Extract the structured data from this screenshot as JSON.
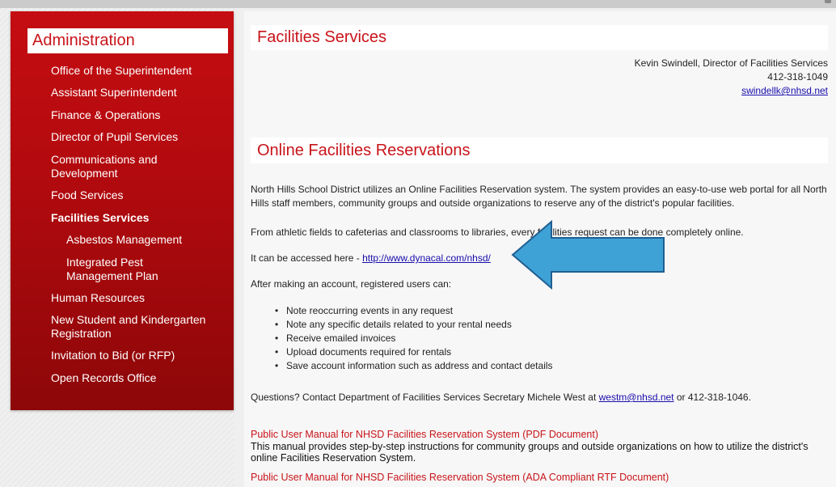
{
  "sidebar": {
    "title": "Administration",
    "items": [
      {
        "label": "Office of the Superintendent"
      },
      {
        "label": "Assistant Superintendent"
      },
      {
        "label": "Finance & Operations"
      },
      {
        "label": "Director of Pupil Services"
      },
      {
        "label": "Communications and Development"
      },
      {
        "label": "Food Services"
      },
      {
        "label": "Facilities Services",
        "active": true
      },
      {
        "label": "Asbestos Management"
      },
      {
        "label": "Integrated Pest Management Plan"
      },
      {
        "label": "Human Resources"
      },
      {
        "label": "New Student and Kindergarten Registration"
      },
      {
        "label": "Invitation to Bid (or RFP)"
      },
      {
        "label": "Open Records Office"
      }
    ]
  },
  "page": {
    "title": "Facilities Services",
    "contact": {
      "name_title": "Kevin Swindell, Director of Facilities Services",
      "phone": "412-318-1049",
      "email": "swindellk@nhsd.net"
    },
    "section_title": "Online Facilities Reservations",
    "intro": "North Hills School District utilizes an Online Facilities Reservation system. The system provides an easy-to-use web portal for all North Hills staff members, community groups and outside organizations to reserve any of the district's popular facilities.",
    "athletic": "From athletic fields to cafeterias and classrooms to libraries, every facilities request can be done completely online.",
    "access_prefix": "It can be accessed here - ",
    "access_link": "http://www.dynacal.com/nhsd/",
    "after_account": "After making an account, registered users can:",
    "features": [
      "Note reoccurring events in any request",
      "Note any specific details related to your rental needs",
      "Receive emailed invoices",
      "Upload documents required for rentals",
      "Save account information such as address and contact details"
    ],
    "questions_prefix": "Questions? Contact Department of Facilities Services Secretary Michele West at ",
    "questions_email": "westm@nhsd.net",
    "questions_suffix": " or 412-318-1046.",
    "manual_pdf": "Public User Manual for NHSD Facilities Reservation System (PDF Document)",
    "manual_desc": "This manual provides step-by-step instructions for community groups and outside organizations on how to utilize the district's online Facilities Reservation System.",
    "manual_rtf": "Public User Manual for NHSD Facilities Reservation System (ADA Compliant RTF Document)"
  },
  "colors": {
    "brand_red": "#c8141a",
    "sidebar_dark_red": "#8d0709",
    "arrow_blue": "#3fa2d6",
    "link_blue": "#1a0dab"
  },
  "icons": {
    "annotation": "arrow-left-icon"
  }
}
